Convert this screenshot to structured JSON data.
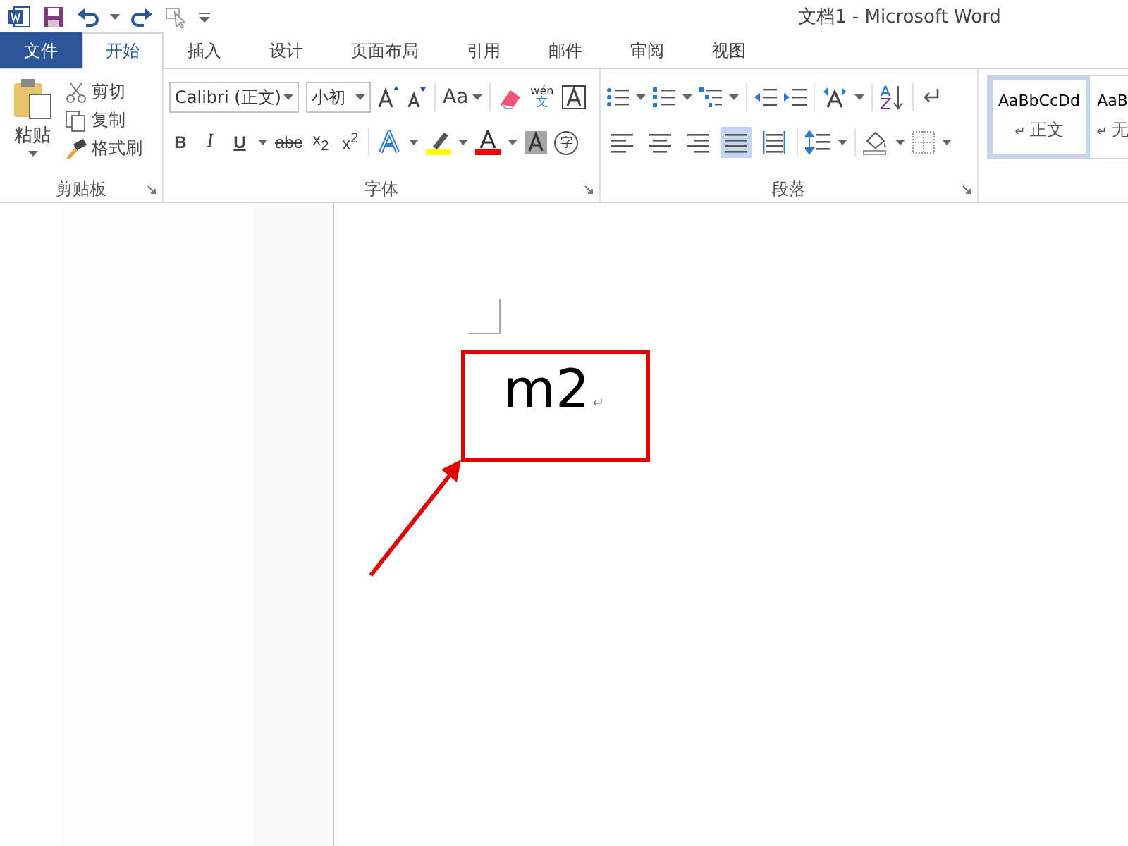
{
  "window": {
    "title": "文档1 - Microsoft Word"
  },
  "quick_access": [
    {
      "kind": "save"
    },
    {
      "kind": "undo"
    },
    {
      "kind": "redo"
    },
    {
      "kind": "touch"
    }
  ],
  "tabs": [
    {
      "label": "文件",
      "kind": "file",
      "selected": false
    },
    {
      "label": "开始",
      "kind": "tab",
      "selected": true
    },
    {
      "label": "插入",
      "kind": "tab",
      "selected": false
    },
    {
      "label": "设计",
      "kind": "tab",
      "selected": false
    },
    {
      "label": "页面布局",
      "kind": "tab",
      "selected": false
    },
    {
      "label": "引用",
      "kind": "tab",
      "selected": false
    },
    {
      "label": "邮件",
      "kind": "tab",
      "selected": false
    },
    {
      "label": "审阅",
      "kind": "tab",
      "selected": false
    },
    {
      "label": "视图",
      "kind": "tab",
      "selected": false
    }
  ],
  "clipboard": {
    "paste": "粘贴",
    "cut": "剪切",
    "copy": "复制",
    "format_painter": "格式刷",
    "label": "剪贴板"
  },
  "font": {
    "font_name": "Calibri (正文)",
    "font_size": "小初",
    "case_button": "Aa",
    "phonetic_top": "wén",
    "phonetic_bottom": "文",
    "enclose": "字",
    "format_buttons": [
      {
        "text": "B",
        "kind": "bold"
      },
      {
        "text": "I",
        "kind": "italic"
      },
      {
        "text": "U",
        "kind": "underline"
      },
      {
        "text": "abc",
        "kind": "strike"
      },
      {
        "text": "x$_{2}$",
        "kind": "plain"
      },
      {
        "text": "x$^{2}$",
        "kind": "plain"
      }
    ],
    "label": "字体"
  },
  "paragraph": {
    "align_buttons": [
      {
        "kind": "left",
        "selected": false
      },
      {
        "kind": "center",
        "selected": false
      },
      {
        "kind": "right",
        "selected": false
      },
      {
        "kind": "justify",
        "selected": true
      },
      {
        "kind": "distributed",
        "selected": false
      }
    ],
    "label": "段落"
  },
  "styles": [
    {
      "sample": "AaBbCcDd",
      "mark": "↵",
      "name": "正文",
      "selected": true
    },
    {
      "sample": "AaB",
      "mark": "↵",
      "name": "无",
      "selected": false
    }
  ],
  "document": {
    "text": "m2",
    "paragraph_mark": "↵"
  }
}
